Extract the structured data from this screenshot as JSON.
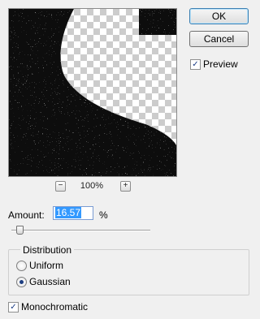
{
  "buttons": {
    "ok": "OK",
    "cancel": "Cancel"
  },
  "preview": {
    "label": "Preview",
    "checked": true
  },
  "zoom": {
    "minus": "−",
    "plus": "+",
    "level": "100%"
  },
  "amount": {
    "label": "Amount:",
    "value": "16.57",
    "unit": "%",
    "slider_fraction": 0.0414
  },
  "distribution": {
    "label": "Distribution",
    "options": [
      {
        "label": "Uniform",
        "selected": false
      },
      {
        "label": "Gaussian",
        "selected": true
      }
    ]
  },
  "monochromatic": {
    "label": "Monochromatic",
    "checked": true
  },
  "icons": {
    "checkmark": "✓"
  },
  "colors": {
    "accent": "#3399ff",
    "selection_text": "#ffffff"
  }
}
